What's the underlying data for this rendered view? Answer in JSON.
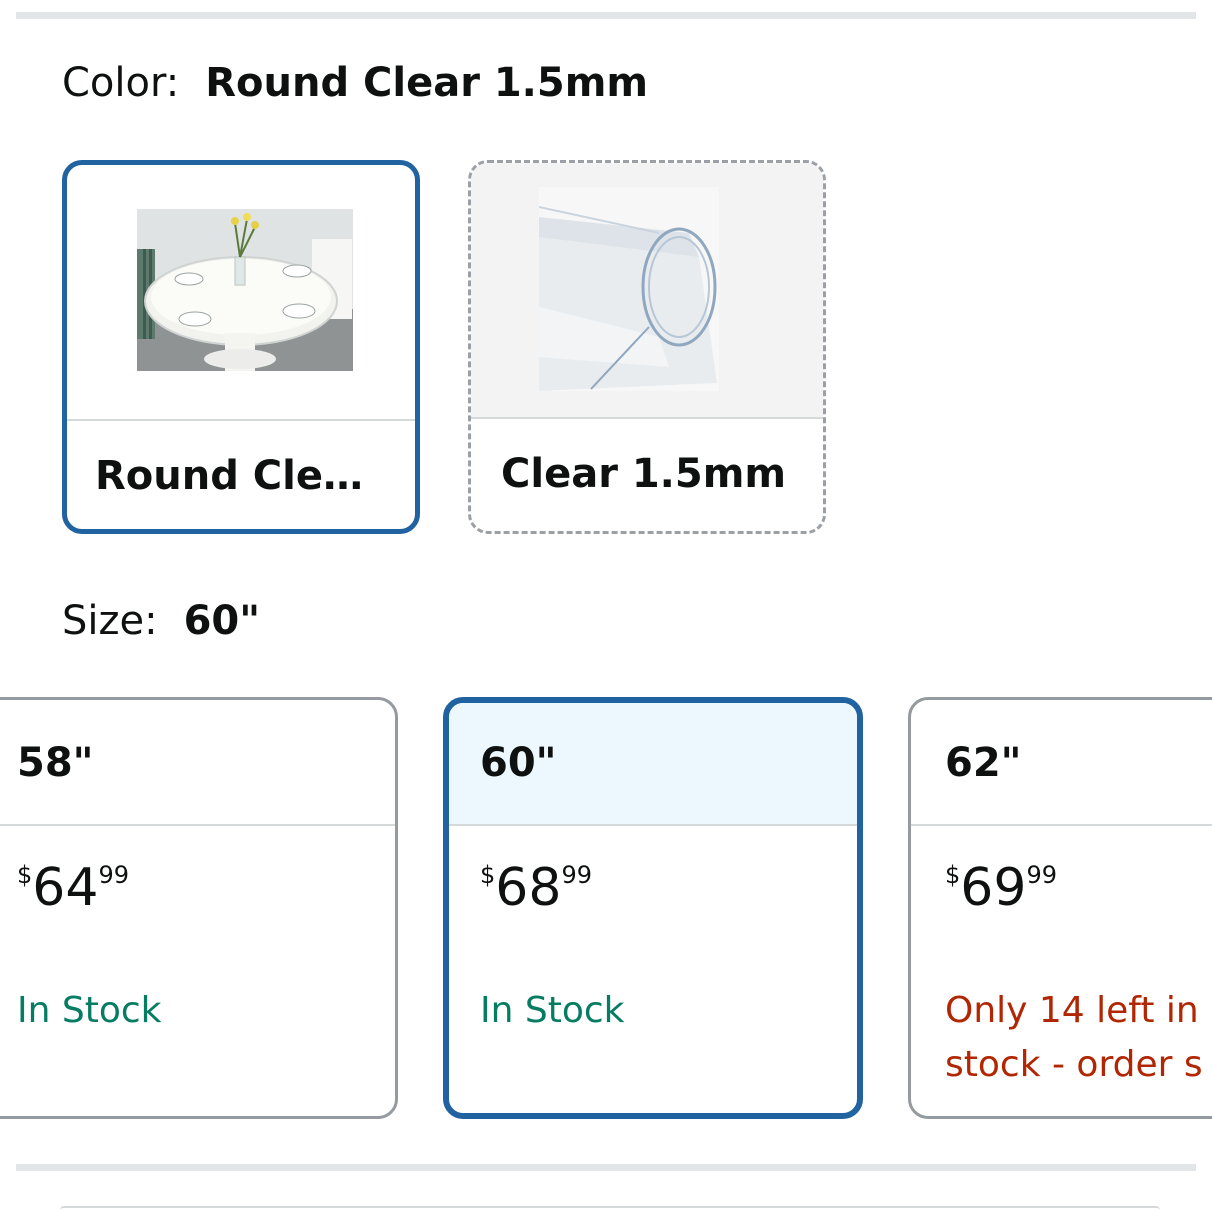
{
  "color": {
    "label": "Color:",
    "selected_value": "Round Clear 1.5mm",
    "options": [
      {
        "name": "Round Clear 1.5mm",
        "display": "Round Clea…",
        "selected": true,
        "image": "round-table-cover-photo"
      },
      {
        "name": "Clear 1.5mm",
        "display": "Clear 1.5mm",
        "selected": false,
        "image": "clear-vinyl-roll-photo"
      }
    ]
  },
  "size": {
    "label": "Size:",
    "selected_value": "60\"",
    "options": [
      {
        "name": "58\"",
        "price_symbol": "$",
        "price_whole": "64",
        "price_cents": "99",
        "availability": "In Stock",
        "availability_status": "in-stock",
        "selected": false
      },
      {
        "name": "60\"",
        "price_symbol": "$",
        "price_whole": "68",
        "price_cents": "99",
        "availability": "In Stock",
        "availability_status": "in-stock",
        "selected": true
      },
      {
        "name": "62\"",
        "price_symbol": "$",
        "price_whole": "69",
        "price_cents": "99",
        "availability_line1": "Only 14 left in",
        "availability_line2": "stock - order s",
        "availability_status": "low-stock",
        "selected": false
      }
    ]
  },
  "colors": {
    "selected_border": "#2162a1",
    "selected_fill": "#edf8fe",
    "in_stock": "#067d62",
    "low_stock": "#b12704"
  }
}
